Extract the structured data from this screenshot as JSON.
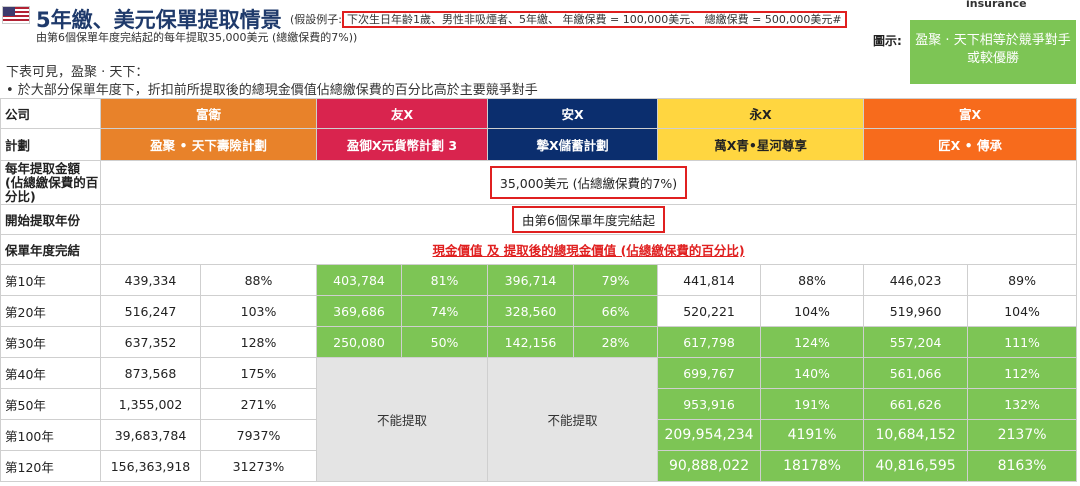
{
  "header": {
    "title": "5年繳、美元保單提取情景",
    "assumption_prefix": "(假設例子:",
    "assumption_box": "下次生日年齡1歲、男性非吸煙者、5年繳、 年繳保費 = 100,000美元、 總繳保費 = 500,000美元#",
    "subline": "由第6個保單年度完結起的每年提取35,000美元 (總繳保費的7%))",
    "insurance_label": "insurance",
    "legend_label": "圖示:",
    "legend_text": "盈聚 · 天下相等於競爭對手或較優勝"
  },
  "intro": {
    "line1": "下表可見，盈聚 · 天下：",
    "line2": "•      於大部分保單年度下，折扣前所提取後的總現金價值佔總繳保費的百分比高於主要競爭對手"
  },
  "table": {
    "row_labels": {
      "company": "公司",
      "plan": "計劃",
      "withdraw_amount": "每年提取金額 (佔總繳保費的百分比)",
      "start_year": "開始提取年份",
      "policy_year_end": "保單年度完結"
    },
    "companies": [
      "富衛",
      "友X",
      "安X",
      "永X",
      "富X"
    ],
    "plans": [
      "盈聚 • 天下壽險計劃",
      "盈御X元貨幣計劃 3",
      "摯X儲蓄計劃",
      "萬X青•星河尊享",
      "匠X • 傳承"
    ],
    "withdraw_value": "35,000美元 (佔總繳保費的7%)",
    "start_value": "由第6個保單年度完結起",
    "section_title": "現金價值 及 提取後的總現金價值 (佔總繳保費的百分比)",
    "not_withdrawable": "不能提取",
    "rows": [
      {
        "year": "第10年",
        "cells": [
          "439,334",
          "88%",
          "403,784",
          "81%",
          "396,714",
          "79%",
          "441,814",
          "88%",
          "446,023",
          "89%"
        ]
      },
      {
        "year": "第20年",
        "cells": [
          "516,247",
          "103%",
          "369,686",
          "74%",
          "328,560",
          "66%",
          "520,221",
          "104%",
          "519,960",
          "104%"
        ]
      },
      {
        "year": "第30年",
        "cells": [
          "637,352",
          "128%",
          "250,080",
          "50%",
          "142,156",
          "28%",
          "617,798",
          "124%",
          "557,204",
          "111%"
        ]
      },
      {
        "year": "第40年",
        "cells": [
          "873,568",
          "175%",
          "",
          "",
          "",
          "",
          "699,767",
          "140%",
          "561,066",
          "112%"
        ]
      },
      {
        "year": "第50年",
        "cells": [
          "1,355,002",
          "271%",
          "",
          "",
          "",
          "",
          "953,916",
          "191%",
          "661,626",
          "132%"
        ]
      },
      {
        "year": "第100年",
        "cells": [
          "39,683,784",
          "7937%",
          "",
          "",
          "",
          "",
          "209,954,234",
          "4191%",
          "10,684,152",
          "2137%"
        ]
      },
      {
        "year": "第120年",
        "cells": [
          "156,363,918",
          "31273%",
          "",
          "",
          "",
          "",
          "90,888,022",
          "18178%",
          "40,816,595",
          "8163%"
        ]
      }
    ]
  },
  "colors": {
    "fwd_orange": "#e8822a",
    "aia_red": "#d9244e",
    "axa_navy": "#0b2e6e",
    "yelow": "#ffd640",
    "orange2": "#f76b1c",
    "highlight_green": "#7dc555",
    "greyed": "#e4e4e4",
    "alert_red": "#e02020"
  }
}
